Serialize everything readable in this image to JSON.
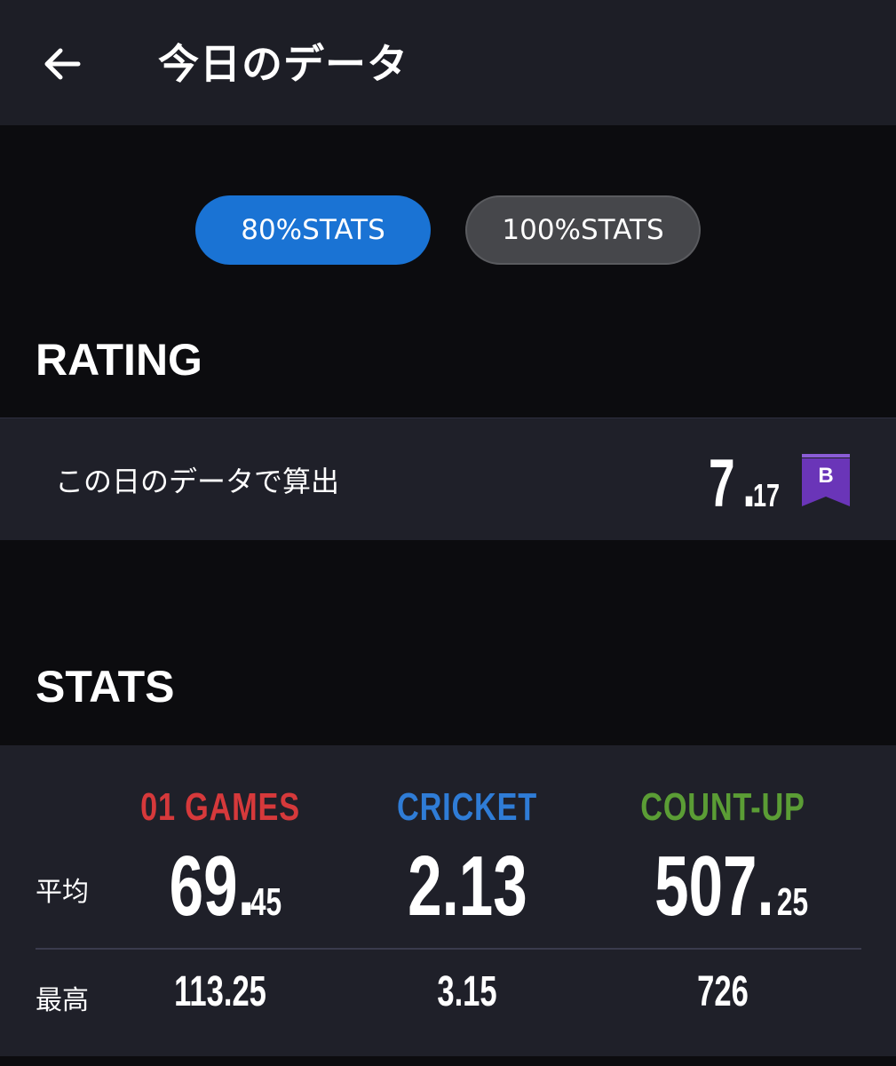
{
  "header": {
    "title": "今日のデータ"
  },
  "toggle": {
    "active_label": "80%STATS",
    "inactive_label": "100%STATS"
  },
  "rating": {
    "section_title": "RATING",
    "label": "この日のデータで算出",
    "value_int": "7",
    "value_dot": ".",
    "value_dec": "17",
    "rank": "B",
    "rank_color": "#6a35b8"
  },
  "stats": {
    "section_title": "STATS",
    "columns": [
      {
        "name": "01 GAMES",
        "color": "#d6393b",
        "avg_int": "69.",
        "avg_dec": "45",
        "max": "113.25"
      },
      {
        "name": "CRICKET",
        "color": "#2f7cd6",
        "avg_int": "2.13",
        "avg_dec": "",
        "max": "3.15"
      },
      {
        "name": "COUNT-UP",
        "color": "#5b9d35",
        "avg_int": "507.",
        "avg_dec": "25",
        "max": "726"
      }
    ],
    "avg_label": "平均",
    "max_label": "最高"
  }
}
